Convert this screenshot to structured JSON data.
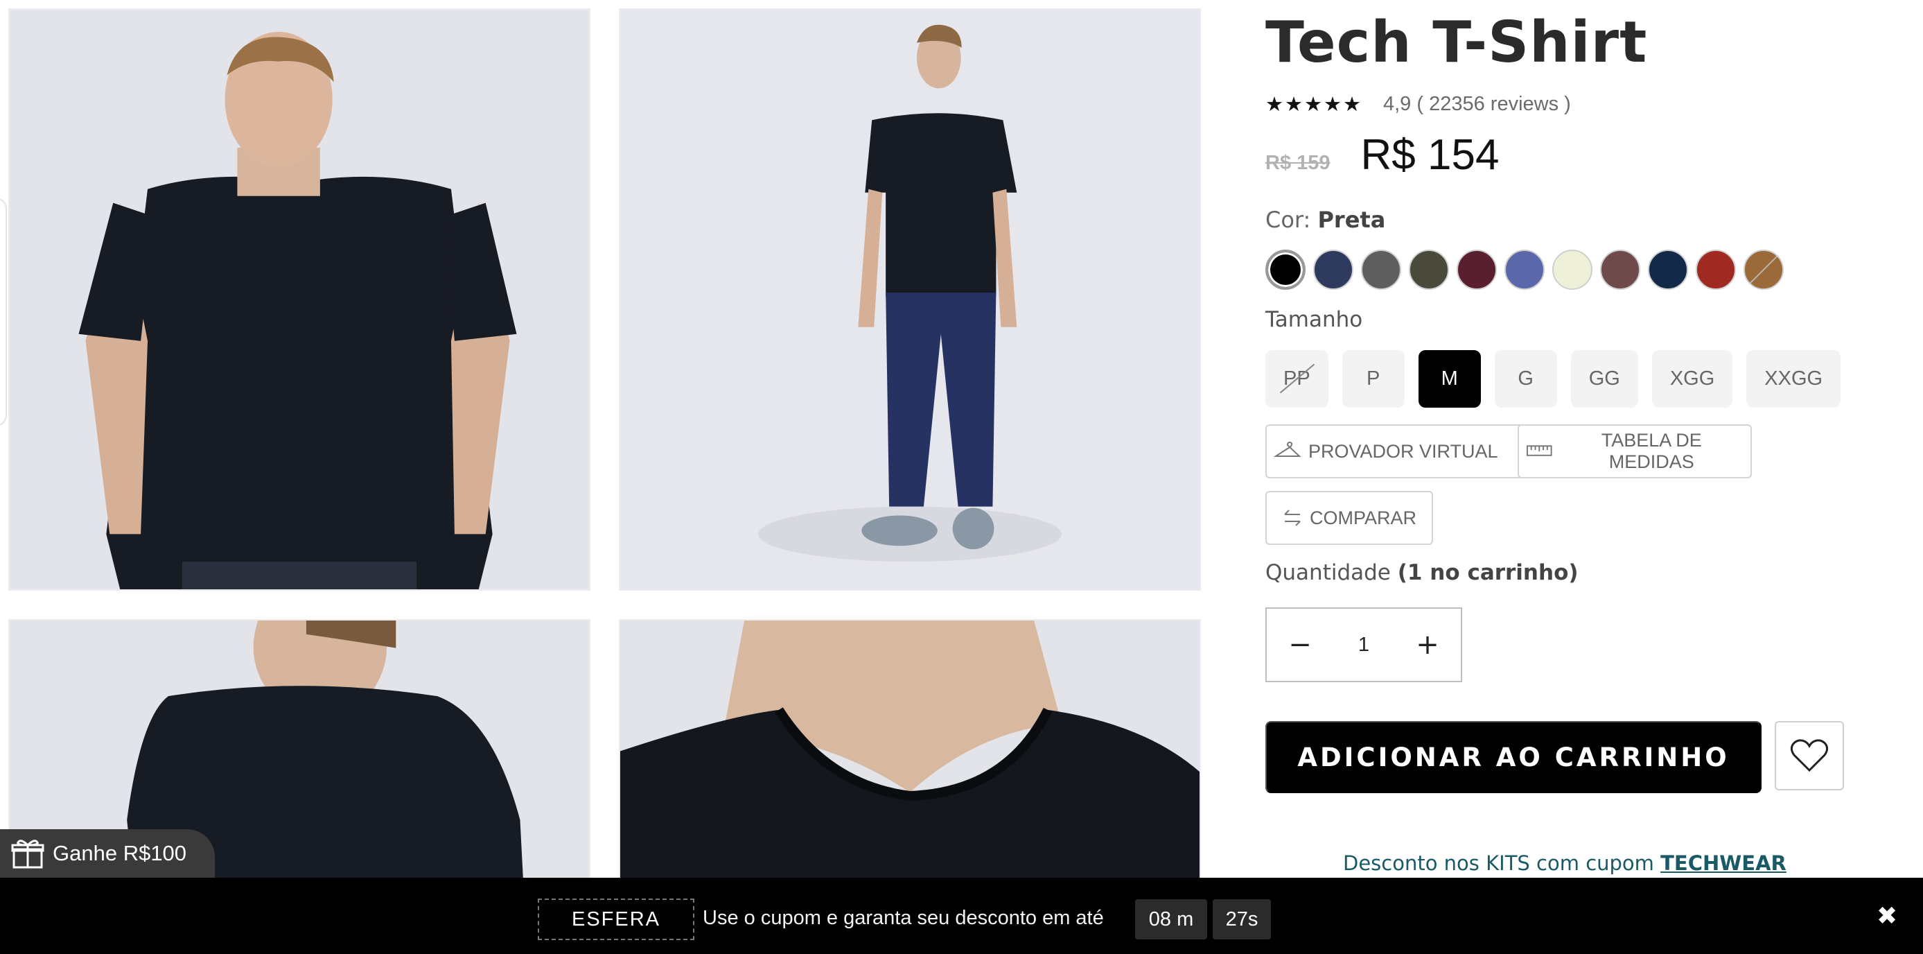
{
  "product": {
    "title": "Tech T-Shirt",
    "stars": "★★★★★",
    "rating_text": "4,9 ( 22356 reviews )",
    "old_price": "R$ 159",
    "price": "R$ 154",
    "color_label": "Cor:",
    "color_value": "Preta",
    "swatches": [
      "#000000",
      "#2e3b5e",
      "#5e5e5e",
      "#4a4a3a",
      "#5a1f2e",
      "#5a67a8",
      "#eef0d8",
      "#6e4a4a",
      "#13294a",
      "#a02a22",
      "#9a6a3a"
    ],
    "size_label": "Tamanho",
    "sizes": [
      "PP",
      "P",
      "M",
      "G",
      "GG",
      "XGG",
      "XXGG"
    ],
    "provador_label": "PROVADOR VIRTUAL",
    "tabela_label": "TABELA DE MEDIDAS",
    "comparar_label": "COMPARAR",
    "qty_label": "Quantidade",
    "qty_cart": "(1 no carrinho)",
    "qty_value": "1",
    "add_to_cart": "ADICIONAR AO CARRINHO",
    "discount_text": "Desconto nos KITS com cupom",
    "discount_code": "TECHWEAR"
  },
  "gift": {
    "label": "Ganhe R$100"
  },
  "bottom_bar": {
    "coupon": "ESFERA",
    "text": "Use o cupom e garanta seu desconto em até",
    "minutes": "08 m",
    "seconds": "27s"
  }
}
